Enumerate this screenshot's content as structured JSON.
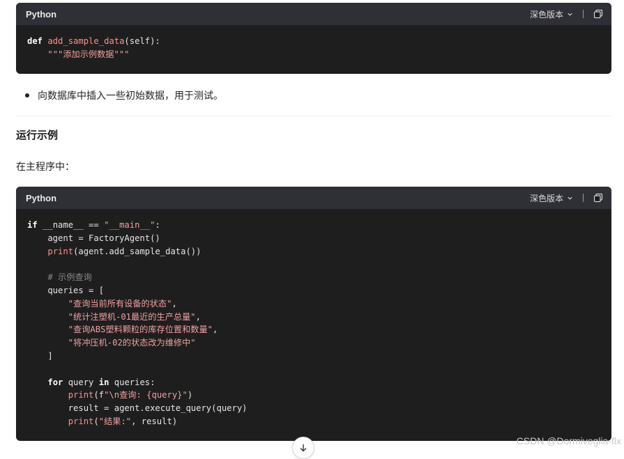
{
  "block1": {
    "language": "Python",
    "theme_label": "深色版本",
    "lines": [
      [
        "def ",
        "add_sample_data",
        "(self):"
      ],
      [
        "    ",
        "\"\"\"添加示例数据\"\"\""
      ]
    ]
  },
  "bullet_text": "向数据库中插入一些初始数据，用于测试。",
  "heading": "运行示例",
  "paragraph": "在主程序中：",
  "block2": {
    "language": "Python",
    "theme_label": "深色版本",
    "code": {
      "l1_kw": "if",
      "l1_rest": " __name__ == ",
      "l1_str": "\"__main__\"",
      "l1_end": ":",
      "l2": "    agent = FactoryAgent()",
      "l3_fn": "print",
      "l3_rest": "(agent.add_sample_data())",
      "l5": "    # 示例查询",
      "l6": "    queries = [",
      "q1": "\"查询当前所有设备的状态\"",
      "q2": "\"统计注塑机-01最近的生产总量\"",
      "q3": "\"查询ABS塑料颗粒的库存位置和数量\"",
      "q4": "\"将冲压机-02的状态改为维修中\"",
      "l11": "    ]",
      "l13_kw1": "for",
      "l13_mid": " query ",
      "l13_kw2": "in",
      "l13_end": " queries:",
      "l14_fn": "print",
      "l14_a": "(f",
      "l14_str": "\"\\n查询: {query}\"",
      "l14_b": ")",
      "l15": "        result = agent.execute_query(query)",
      "l16_fn": "print",
      "l16_a": "(",
      "l16_str": "\"结果:\"",
      "l16_b": ", result)"
    }
  },
  "watermark": "CSDN @Dormiveglia-flx",
  "icons": {
    "copy": "copy-icon",
    "chevron": "chevron-down-icon",
    "scroll": "arrow-down-icon"
  }
}
